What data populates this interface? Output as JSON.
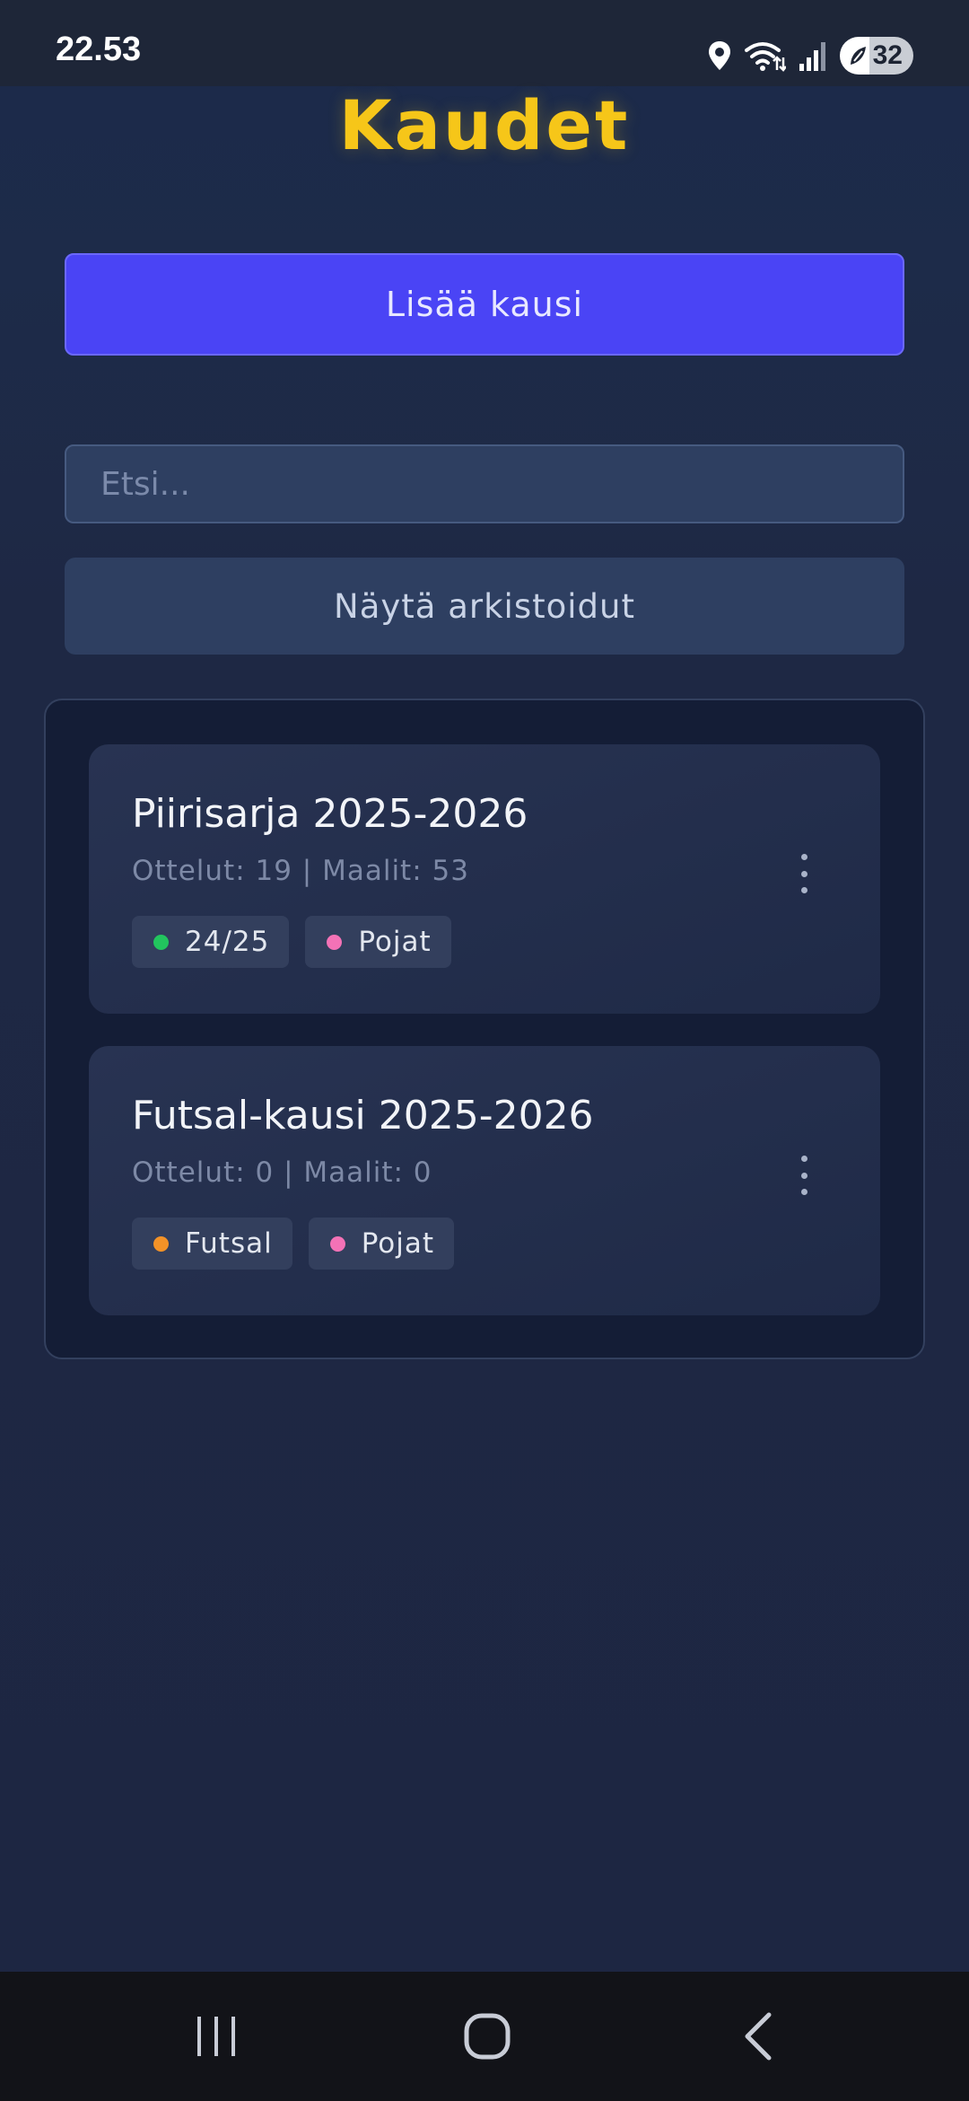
{
  "status_bar": {
    "time": "22.53",
    "battery_percent": "32",
    "icons": [
      "location-icon",
      "wifi-icon",
      "signal-icon",
      "battery-icon"
    ]
  },
  "page": {
    "title": "Kaudet",
    "add_button_label": "Lisää kausi",
    "search_placeholder": "Etsi...",
    "archived_button_label": "Näytä arkistoidut"
  },
  "seasons": [
    {
      "title": "Piirisarja 2025-2026",
      "stats": "Ottelut: 19 | Maalit: 53",
      "tags": [
        {
          "label": "24/25",
          "color": "#22c55e"
        },
        {
          "label": "Pojat",
          "color": "#f472b6"
        }
      ]
    },
    {
      "title": "Futsal-kausi 2025-2026",
      "stats": "Ottelut: 0 | Maalit: 0",
      "tags": [
        {
          "label": "Futsal",
          "color": "#f39227"
        },
        {
          "label": "Pojat",
          "color": "#f472b6"
        }
      ]
    }
  ],
  "nav_bar": {
    "icons": [
      "recents-icon",
      "home-icon",
      "back-icon"
    ]
  },
  "colors": {
    "title": "#f6c619",
    "primary_button": "#4a44f5",
    "background": "#1c2742"
  }
}
